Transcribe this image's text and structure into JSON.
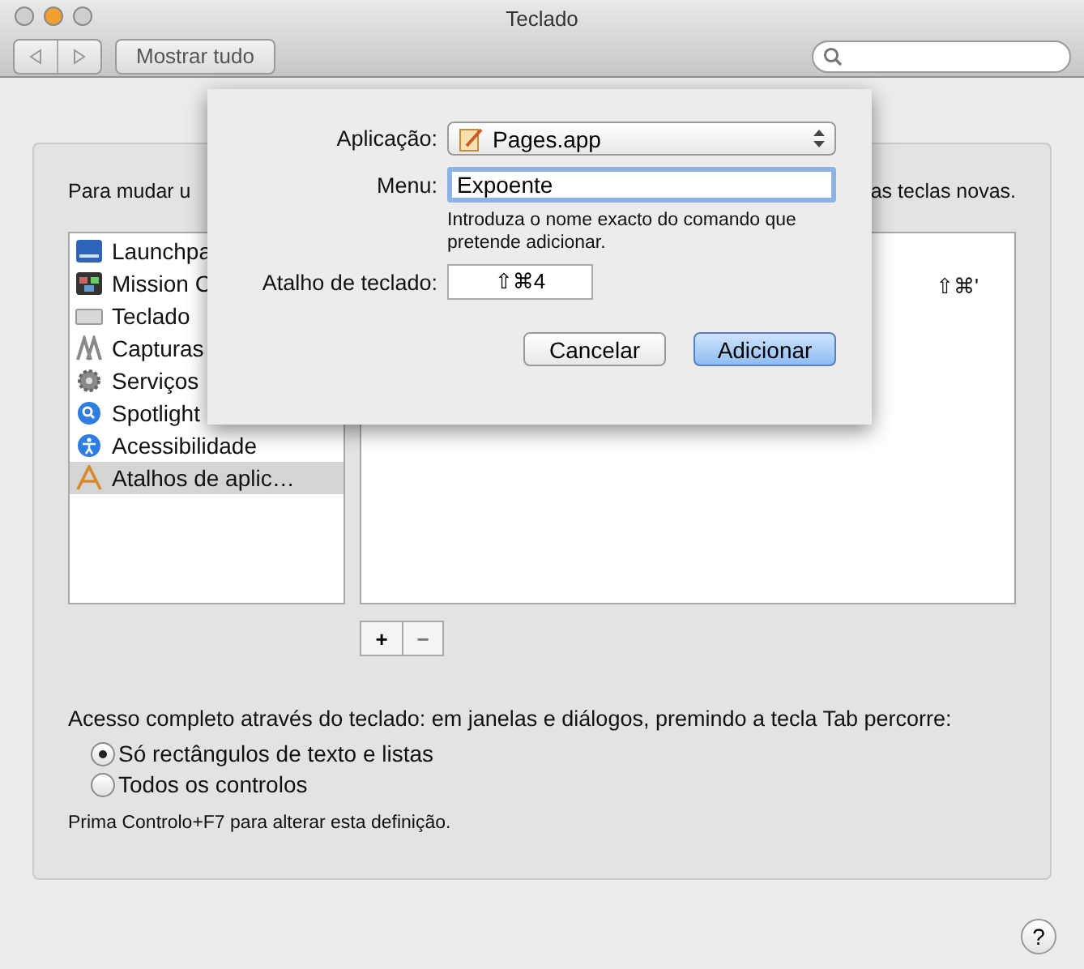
{
  "window": {
    "title": "Teclado"
  },
  "toolbar": {
    "show_all": "Mostrar tudo"
  },
  "intro": {
    "left": "Para mudar u",
    "right": "as teclas novas."
  },
  "categories": [
    {
      "label": "Launchpa",
      "selected": false
    },
    {
      "label": "Mission C",
      "selected": false
    },
    {
      "label": "Teclado",
      "selected": false
    },
    {
      "label": "Capturas",
      "selected": false
    },
    {
      "label": "Serviços",
      "selected": false
    },
    {
      "label": "Spotlight",
      "selected": false
    },
    {
      "label": "Acessibilidade",
      "selected": false
    },
    {
      "label": "Atalhos de aplic…",
      "selected": true
    }
  ],
  "shortcuts": [
    {
      "keys": "⇧⌘'"
    }
  ],
  "list_buttons": [
    "+",
    "−"
  ],
  "full_access": {
    "label": "Acesso completo através do teclado: em janelas e diálogos, premindo a tecla Tab percorre:",
    "options": [
      {
        "label": "Só rectângulos de texto e listas",
        "selected": true
      },
      {
        "label": "Todos os controlos",
        "selected": false
      }
    ],
    "note": "Prima Controlo+F7 para alterar esta definição."
  },
  "help": "?",
  "sheet": {
    "application_label": "Aplicação:",
    "application": "Pages.app",
    "menu_label": "Menu:",
    "menu_value": "Expoente",
    "hint": "Introduza o nome exacto do comando que pretende adicionar.",
    "shortcut_label": "Atalho de teclado:",
    "shortcut_value": "⇧⌘4",
    "buttons": [
      {
        "label": "Cancelar",
        "default": false
      },
      {
        "label": "Adicionar",
        "default": true
      }
    ]
  }
}
